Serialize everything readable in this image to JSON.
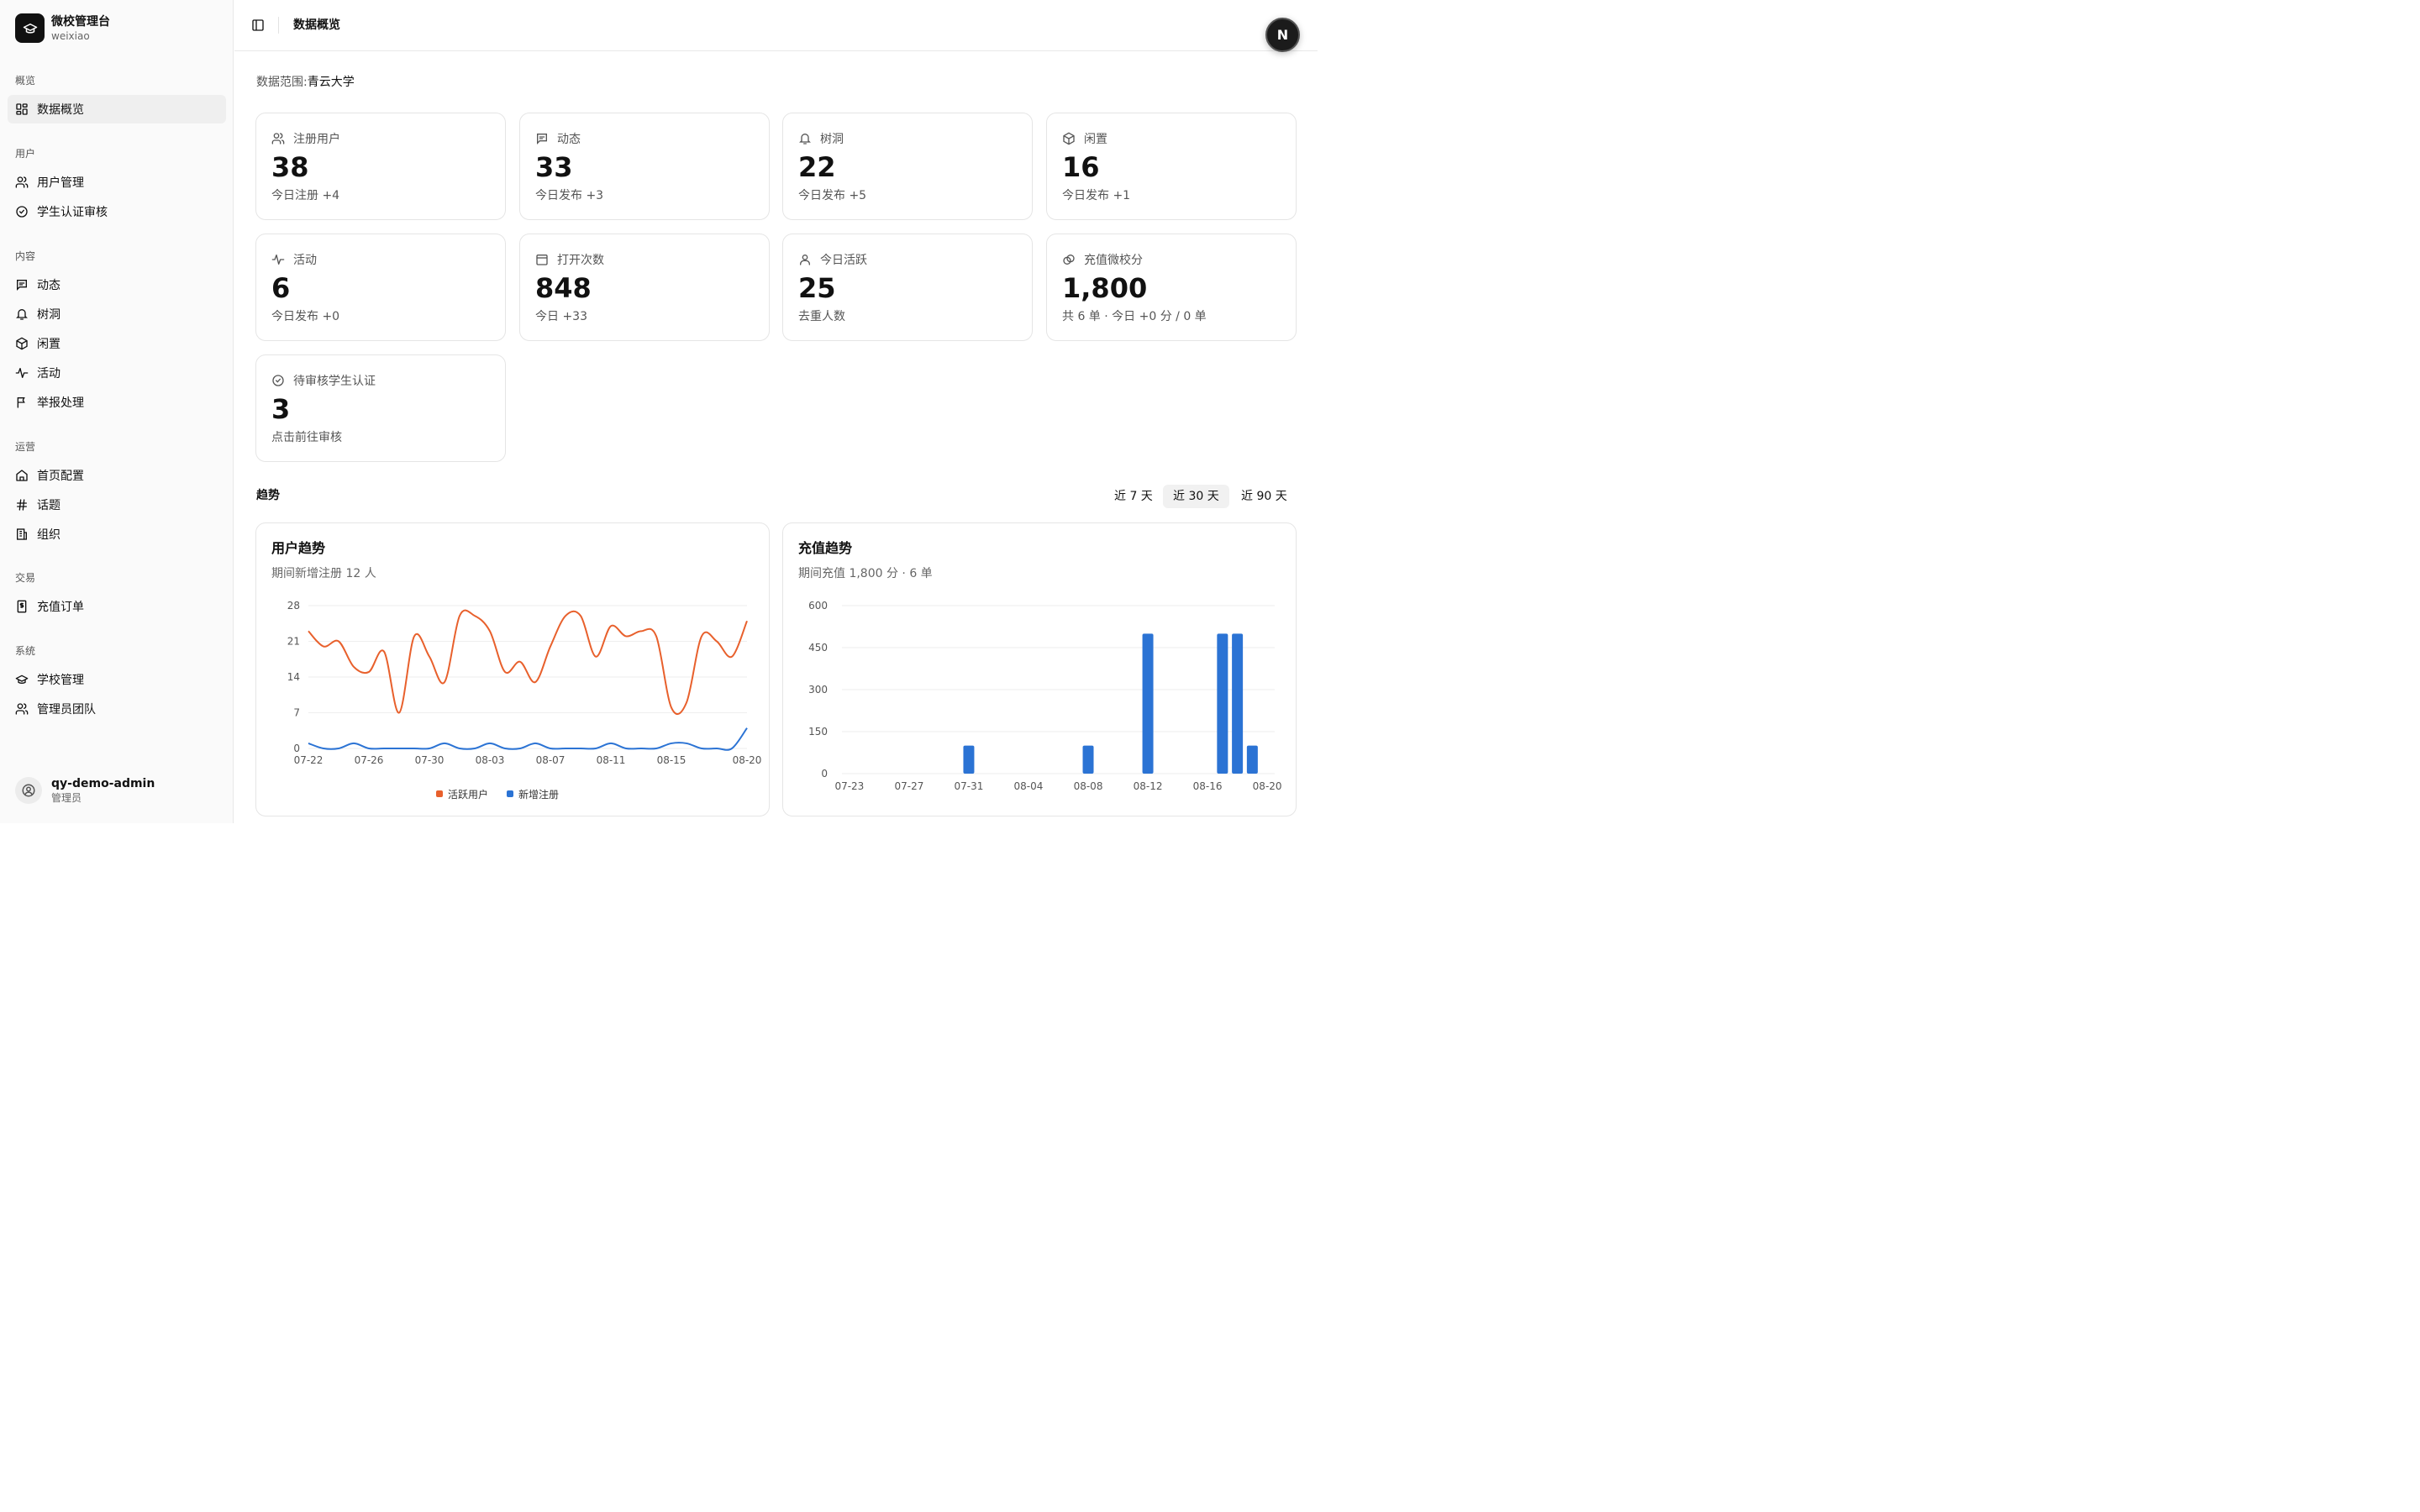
{
  "app": {
    "name": "微校管理台",
    "sub": "weixiao"
  },
  "sidebar": {
    "groups": [
      {
        "title": "概览",
        "items": [
          {
            "label": "数据概览",
            "icon": "dashboard-icon"
          }
        ]
      },
      {
        "title": "用户",
        "items": [
          {
            "label": "用户管理",
            "icon": "users-icon"
          },
          {
            "label": "学生认证审核",
            "icon": "check-circle-icon"
          }
        ]
      },
      {
        "title": "内容",
        "items": [
          {
            "label": "动态",
            "icon": "message-icon"
          },
          {
            "label": "树洞",
            "icon": "bell-icon"
          },
          {
            "label": "闲置",
            "icon": "package-icon"
          },
          {
            "label": "活动",
            "icon": "activity-icon"
          },
          {
            "label": "举报处理",
            "icon": "flag-icon"
          }
        ]
      },
      {
        "title": "运营",
        "items": [
          {
            "label": "首页配置",
            "icon": "home-icon"
          },
          {
            "label": "话题",
            "icon": "hash-icon"
          },
          {
            "label": "组织",
            "icon": "building-icon"
          }
        ]
      },
      {
        "title": "交易",
        "items": [
          {
            "label": "充值订单",
            "icon": "receipt-icon"
          }
        ]
      },
      {
        "title": "系统",
        "items": [
          {
            "label": "学校管理",
            "icon": "graduation-cap-icon"
          },
          {
            "label": "管理员团队",
            "icon": "team-icon"
          }
        ]
      }
    ],
    "user": {
      "name": "qy-demo-admin",
      "role": "管理员"
    }
  },
  "header": {
    "breadcrumb": "数据概览",
    "avatar_letter": "N"
  },
  "scope": {
    "label": "数据范围:",
    "value": "青云大学"
  },
  "cards": [
    {
      "label": "注册用户",
      "value": "38",
      "sub": "今日注册 +4",
      "icon": "users-icon"
    },
    {
      "label": "动态",
      "value": "33",
      "sub": "今日发布 +3",
      "icon": "message-icon"
    },
    {
      "label": "树洞",
      "value": "22",
      "sub": "今日发布 +5",
      "icon": "bell-icon"
    },
    {
      "label": "闲置",
      "value": "16",
      "sub": "今日发布 +1",
      "icon": "package-icon"
    },
    {
      "label": "活动",
      "value": "6",
      "sub": "今日发布 +0",
      "icon": "activity-icon"
    },
    {
      "label": "打开次数",
      "value": "848",
      "sub": "今日 +33",
      "icon": "calendar-icon"
    },
    {
      "label": "今日活跃",
      "value": "25",
      "sub": "去重人数",
      "icon": "user-icon"
    },
    {
      "label": "充值微校分",
      "value": "1,800",
      "sub": "共 6 单 · 今日 +0 分 / 0 单",
      "icon": "coins-icon"
    },
    {
      "label": "待审核学生认证",
      "value": "3",
      "sub": "点击前往审核",
      "icon": "check-circle-icon"
    }
  ],
  "trend": {
    "title": "趋势",
    "ranges": [
      "近 7 天",
      "近 30 天",
      "近 90 天"
    ],
    "active_range": "近 30 天"
  },
  "colors": {
    "active_users": "#e8602c",
    "new_users": "#2b73d4",
    "recharge": "#2b73d4"
  },
  "chart_data": [
    {
      "type": "line",
      "title": "用户趋势",
      "subtitle": "期间新增注册 12 人",
      "x": [
        "07-22",
        "07-23",
        "07-24",
        "07-25",
        "07-26",
        "07-27",
        "07-28",
        "07-29",
        "07-30",
        "07-31",
        "08-01",
        "08-02",
        "08-03",
        "08-04",
        "08-05",
        "08-06",
        "08-07",
        "08-08",
        "08-09",
        "08-10",
        "08-11",
        "08-12",
        "08-13",
        "08-14",
        "08-15",
        "08-16",
        "08-17",
        "08-18",
        "08-19",
        "08-20"
      ],
      "xticks": [
        "07-22",
        "07-26",
        "07-30",
        "08-03",
        "08-07",
        "08-11",
        "08-15",
        "08-20"
      ],
      "ylim": [
        0,
        28
      ],
      "yticks": [
        0,
        7,
        14,
        21,
        28
      ],
      "series": [
        {
          "name": "活跃用户",
          "values": [
            23,
            20,
            21,
            16,
            15,
            19,
            7,
            22,
            18,
            13,
            26,
            26,
            23,
            15,
            17,
            13,
            20,
            26,
            26,
            18,
            24,
            22,
            23,
            22,
            8,
            9,
            22,
            21,
            18,
            25
          ]
        },
        {
          "name": "新增注册",
          "values": [
            1,
            0,
            0,
            1,
            0,
            0,
            0,
            0,
            0,
            1,
            0,
            0,
            1,
            0,
            0,
            1,
            0,
            0,
            0,
            0,
            1,
            0,
            0,
            0,
            1,
            1,
            0,
            0,
            0,
            4
          ]
        }
      ]
    },
    {
      "type": "bar",
      "title": "充值趋势",
      "subtitle": "期间充值 1,800 分 · 6 单",
      "categories": [
        "07-23",
        "07-24",
        "07-25",
        "07-26",
        "07-27",
        "07-28",
        "07-29",
        "07-30",
        "07-31",
        "08-01",
        "08-02",
        "08-03",
        "08-04",
        "08-05",
        "08-06",
        "08-07",
        "08-08",
        "08-09",
        "08-10",
        "08-11",
        "08-12",
        "08-13",
        "08-14",
        "08-15",
        "08-16",
        "08-17",
        "08-18",
        "08-19",
        "08-20"
      ],
      "xticks": [
        "07-23",
        "07-27",
        "07-31",
        "08-04",
        "08-08",
        "08-12",
        "08-16",
        "08-20"
      ],
      "values": [
        0,
        0,
        0,
        0,
        0,
        0,
        0,
        0,
        100,
        0,
        0,
        0,
        0,
        0,
        0,
        0,
        100,
        0,
        0,
        0,
        500,
        0,
        0,
        0,
        0,
        500,
        500,
        100,
        0
      ],
      "ylim": [
        0,
        600
      ],
      "yticks": [
        0,
        150,
        300,
        450,
        600
      ]
    }
  ]
}
